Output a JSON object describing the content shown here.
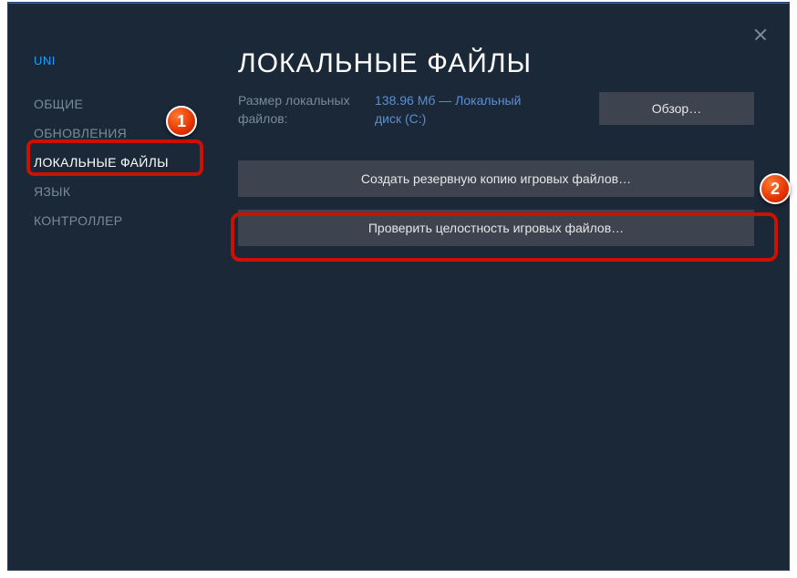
{
  "app_name": "UNI",
  "sidebar": {
    "items": [
      {
        "label": "ОБЩИЕ"
      },
      {
        "label": "ОБНОВЛЕНИЯ"
      },
      {
        "label": "ЛОКАЛЬНЫЕ ФАЙЛЫ"
      },
      {
        "label": "ЯЗЫК"
      },
      {
        "label": "КОНТРОЛЛЕР"
      }
    ]
  },
  "main": {
    "title": "ЛОКАЛЬНЫЕ ФАЙЛЫ",
    "size_label": "Размер локальных файлов:",
    "size_value": "138.96 Мб — Локальный диск (C:)",
    "browse_label": "Обзор…",
    "backup_label": "Создать резервную копию игровых файлов…",
    "verify_label": "Проверить целостность игровых файлов…"
  },
  "markers": {
    "one": "1",
    "two": "2"
  }
}
